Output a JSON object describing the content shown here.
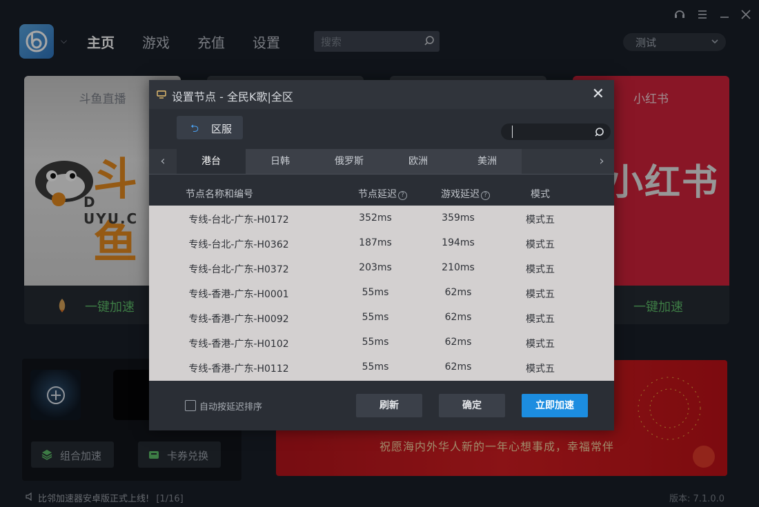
{
  "app": {
    "nav": [
      "主页",
      "游戏",
      "充值",
      "设置"
    ],
    "search_placeholder": "搜索",
    "region_select": "测试",
    "version": "版本: 7.1.0.0",
    "status_message": "比邻加速器安卓版正式上线!",
    "status_page": "[1/16]"
  },
  "background": {
    "card_left_title": "斗鱼直播",
    "card_left_btn": "一键加速",
    "douyu_text": "斗鱼",
    "douyu_sub": "D  UYU.C",
    "card_right_title": "小红书",
    "card_right_btn": "一键加速",
    "xhs_text": "小红书",
    "combo_btn": "组合加速",
    "coupon_btn": "卡券兑换",
    "banner_text": "祝愿海内外华人新的一年心想事成，幸福常伴"
  },
  "dialog": {
    "title": "设置节点 - 全民K歌|全区",
    "back_label": "区服",
    "tabs": [
      "港台",
      "日韩",
      "俄罗斯",
      "欧洲",
      "美洲"
    ],
    "active_tab": 0,
    "columns": [
      "节点名称和编号",
      "节点延迟",
      "游戏延迟",
      "模式"
    ],
    "rows": [
      {
        "name": "专线-台北-广东-H0172",
        "node_latency": "352ms",
        "game_latency": "359ms",
        "mode": "模式五"
      },
      {
        "name": "专线-台北-广东-H0362",
        "node_latency": "187ms",
        "game_latency": "194ms",
        "mode": "模式五"
      },
      {
        "name": "专线-台北-广东-H0372",
        "node_latency": "203ms",
        "game_latency": "210ms",
        "mode": "模式五"
      },
      {
        "name": "专线-香港-广东-H0001",
        "node_latency": "55ms",
        "game_latency": "62ms",
        "mode": "模式五"
      },
      {
        "name": "专线-香港-广东-H0092",
        "node_latency": "55ms",
        "game_latency": "62ms",
        "mode": "模式五"
      },
      {
        "name": "专线-香港-广东-H0102",
        "node_latency": "55ms",
        "game_latency": "62ms",
        "mode": "模式五"
      },
      {
        "name": "专线-香港-广东-H0112",
        "node_latency": "55ms",
        "game_latency": "62ms",
        "mode": "模式五"
      }
    ],
    "auto_sort_label": "自动按延迟排序",
    "refresh_btn": "刷新",
    "confirm_btn": "确定",
    "accelerate_btn": "立即加速",
    "colors": {
      "primary": "#1c8de0",
      "accent_green": "#5fbf6a"
    }
  }
}
